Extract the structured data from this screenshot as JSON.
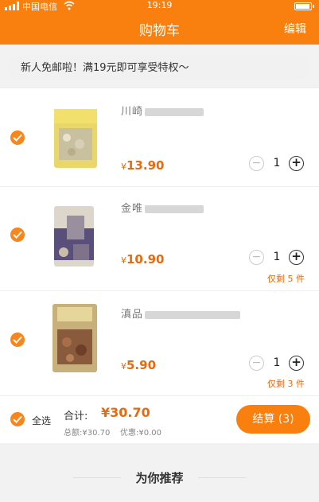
{
  "status_bar": {
    "carrier": "中国电信",
    "time": "19:19"
  },
  "nav": {
    "title": "购物车",
    "edit": "编辑"
  },
  "banner": {
    "text": "新人免邮啦！满19元即可享受特权～"
  },
  "items": [
    {
      "name": "川崎",
      "price_symbol": "¥",
      "price": "13.90",
      "quantity": "1",
      "stock_note": ""
    },
    {
      "name": "金唯",
      "price_symbol": "¥",
      "price": "10.90",
      "quantity": "1",
      "stock_note": "仅剩 5 件"
    },
    {
      "name": "滇品",
      "price_symbol": "¥",
      "price": "5.90",
      "quantity": "1",
      "stock_note": "仅剩 3 件"
    }
  ],
  "footer": {
    "select_all": "全选",
    "total_label": "合计:",
    "total_value": "¥30.70",
    "subtotal": "总额:¥30.70",
    "discount": "优惠:¥0.00",
    "checkout": "结算 (3)"
  },
  "recommend": {
    "title": "为你推荐"
  },
  "colors": {
    "accent": "#f97f0f",
    "price": "#e96a0d"
  },
  "icons": [
    "signal-icon",
    "wifi-icon",
    "battery-icon",
    "checkmark-icon",
    "minus-icon",
    "plus-icon"
  ]
}
